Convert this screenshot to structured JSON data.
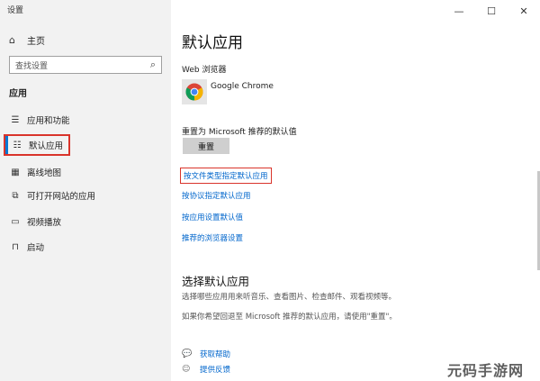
{
  "window": {
    "title": "设置"
  },
  "window_controls": {
    "minimize": "—",
    "maximize": "☐",
    "close": "✕"
  },
  "sidebar": {
    "home": {
      "icon": "home-icon",
      "label": "主页"
    },
    "search": {
      "placeholder": "查找设置"
    },
    "section_title": "应用",
    "items": [
      {
        "icon": "apps-features-icon",
        "label": "应用和功能"
      },
      {
        "icon": "default-apps-icon",
        "label": "默认应用",
        "active": true
      },
      {
        "icon": "offline-maps-icon",
        "label": "离线地图"
      },
      {
        "icon": "website-apps-icon",
        "label": "可打开网站的应用"
      },
      {
        "icon": "video-playback-icon",
        "label": "视频播放"
      },
      {
        "icon": "startup-icon",
        "label": "启动"
      }
    ]
  },
  "main": {
    "title": "默认应用",
    "web_browser_label": "Web 浏览器",
    "browser": {
      "icon": "chrome-icon",
      "name": "Google Chrome"
    },
    "reset_label": "重置为 Microsoft 推荐的默认值",
    "reset_button": "重置",
    "links": [
      "按文件类型指定默认应用",
      "按协议指定默认应用",
      "按应用设置默认值",
      "推荐的浏览器设置"
    ],
    "choose_title": "选择默认应用",
    "choose_desc": "选择哪些应用用来听音乐、查看图片、检查邮件、观看视频等。",
    "revert_desc": "如果你希望回退至 Microsoft 推荐的默认应用，请使用\"重置\"。",
    "help": [
      {
        "icon": "help-icon",
        "label": "获取帮助"
      },
      {
        "icon": "feedback-icon",
        "label": "提供反馈"
      }
    ]
  },
  "watermark": "元码手游网",
  "colors": {
    "accent": "#0078d4",
    "link": "#0066cc",
    "highlight_box": "#d9342b",
    "sidebar_bg": "#f2f2f2"
  }
}
